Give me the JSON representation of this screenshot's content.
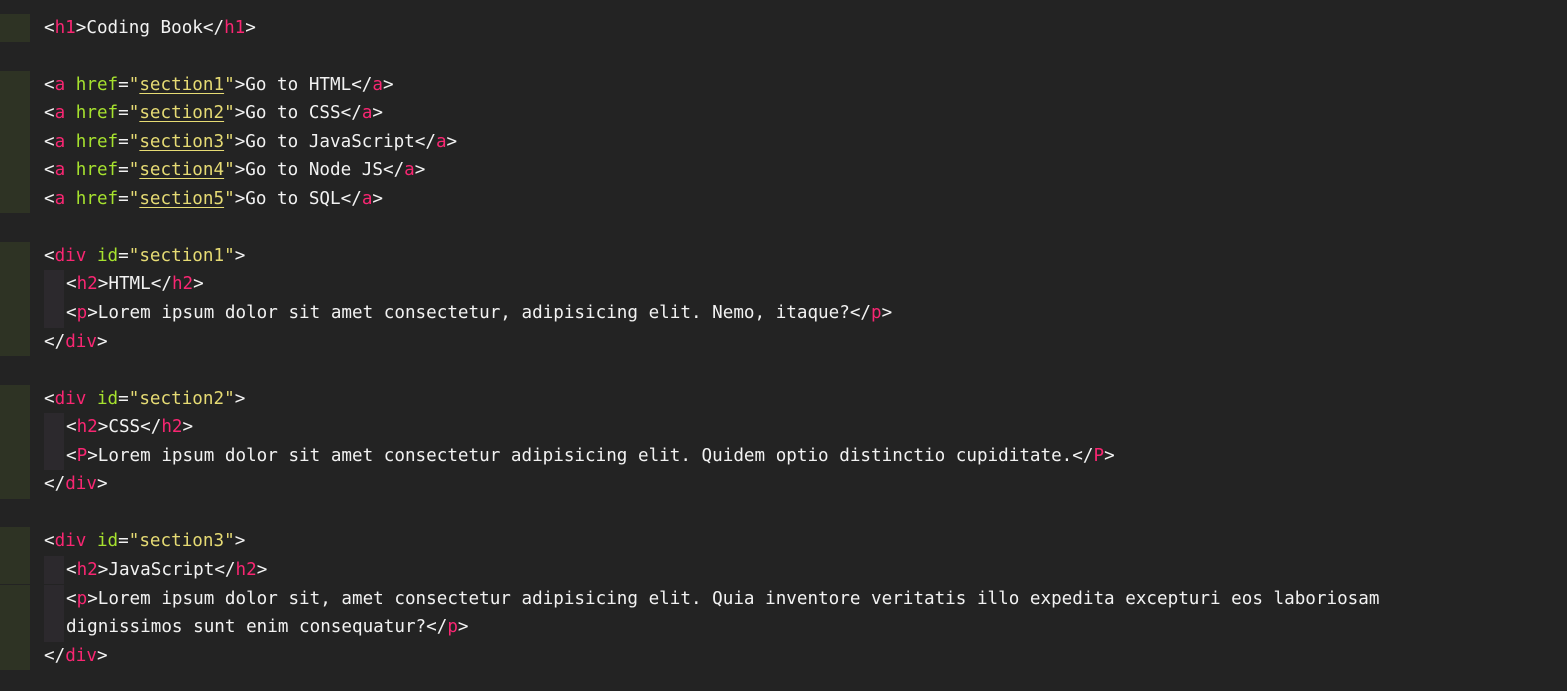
{
  "colors": {
    "background": "#232323",
    "gutter_modified": "#2e3324",
    "indent_guide": "#2c292d",
    "punctuation": "#f2f2f2",
    "tag": "#f92672",
    "attribute": "#a6e22e",
    "string": "#e6db74",
    "text": "#f2f2f2"
  },
  "lines": [
    {
      "tokens": [
        [
          "p",
          "<"
        ],
        [
          "t",
          "h1"
        ],
        [
          "p",
          ">"
        ],
        [
          "txt",
          "Coding Book"
        ],
        [
          "p",
          "</"
        ],
        [
          "t",
          "h1"
        ],
        [
          "p",
          ">"
        ]
      ]
    },
    {
      "tokens": []
    },
    {
      "tokens": [
        [
          "p",
          "<"
        ],
        [
          "t",
          "a"
        ],
        [
          "p",
          " "
        ],
        [
          "a",
          "href"
        ],
        [
          "p",
          "="
        ],
        [
          "s",
          "\""
        ],
        [
          "su",
          "section1"
        ],
        [
          "s",
          "\""
        ],
        [
          "p",
          ">"
        ],
        [
          "txt",
          "Go to HTML"
        ],
        [
          "p",
          "</"
        ],
        [
          "t",
          "a"
        ],
        [
          "p",
          ">"
        ]
      ]
    },
    {
      "tokens": [
        [
          "p",
          "<"
        ],
        [
          "t",
          "a"
        ],
        [
          "p",
          " "
        ],
        [
          "a",
          "href"
        ],
        [
          "p",
          "="
        ],
        [
          "s",
          "\""
        ],
        [
          "su",
          "section2"
        ],
        [
          "s",
          "\""
        ],
        [
          "p",
          ">"
        ],
        [
          "txt",
          "Go to CSS"
        ],
        [
          "p",
          "</"
        ],
        [
          "t",
          "a"
        ],
        [
          "p",
          ">"
        ]
      ]
    },
    {
      "tokens": [
        [
          "p",
          "<"
        ],
        [
          "t",
          "a"
        ],
        [
          "p",
          " "
        ],
        [
          "a",
          "href"
        ],
        [
          "p",
          "="
        ],
        [
          "s",
          "\""
        ],
        [
          "su",
          "section3"
        ],
        [
          "s",
          "\""
        ],
        [
          "p",
          ">"
        ],
        [
          "txt",
          "Go to JavaScript"
        ],
        [
          "p",
          "</"
        ],
        [
          "t",
          "a"
        ],
        [
          "p",
          ">"
        ]
      ]
    },
    {
      "tokens": [
        [
          "p",
          "<"
        ],
        [
          "t",
          "a"
        ],
        [
          "p",
          " "
        ],
        [
          "a",
          "href"
        ],
        [
          "p",
          "="
        ],
        [
          "s",
          "\""
        ],
        [
          "su",
          "section4"
        ],
        [
          "s",
          "\""
        ],
        [
          "p",
          ">"
        ],
        [
          "txt",
          "Go to Node JS"
        ],
        [
          "p",
          "</"
        ],
        [
          "t",
          "a"
        ],
        [
          "p",
          ">"
        ]
      ]
    },
    {
      "tokens": [
        [
          "p",
          "<"
        ],
        [
          "t",
          "a"
        ],
        [
          "p",
          " "
        ],
        [
          "a",
          "href"
        ],
        [
          "p",
          "="
        ],
        [
          "s",
          "\""
        ],
        [
          "su",
          "section5"
        ],
        [
          "s",
          "\""
        ],
        [
          "p",
          ">"
        ],
        [
          "txt",
          "Go to SQL"
        ],
        [
          "p",
          "</"
        ],
        [
          "t",
          "a"
        ],
        [
          "p",
          ">"
        ]
      ]
    },
    {
      "tokens": []
    },
    {
      "tokens": [
        [
          "p",
          "<"
        ],
        [
          "t",
          "div"
        ],
        [
          "p",
          " "
        ],
        [
          "a",
          "id"
        ],
        [
          "p",
          "="
        ],
        [
          "s",
          "\"section1\""
        ],
        [
          "p",
          ">"
        ]
      ]
    },
    {
      "tokens": [
        [
          "p",
          "<"
        ],
        [
          "t",
          "h2"
        ],
        [
          "p",
          ">"
        ],
        [
          "txt",
          "HTML"
        ],
        [
          "p",
          "</"
        ],
        [
          "t",
          "h2"
        ],
        [
          "p",
          ">"
        ]
      ]
    },
    {
      "tokens": [
        [
          "p",
          "<"
        ],
        [
          "t",
          "p"
        ],
        [
          "p",
          ">"
        ],
        [
          "txt",
          "Lorem ipsum dolor sit amet consectetur, adipisicing elit. Nemo, itaque?"
        ],
        [
          "p",
          "</"
        ],
        [
          "t",
          "p"
        ],
        [
          "p",
          ">"
        ]
      ]
    },
    {
      "tokens": [
        [
          "p",
          "</"
        ],
        [
          "t",
          "div"
        ],
        [
          "p",
          ">"
        ]
      ]
    },
    {
      "tokens": []
    },
    {
      "tokens": [
        [
          "p",
          "<"
        ],
        [
          "t",
          "div"
        ],
        [
          "p",
          " "
        ],
        [
          "a",
          "id"
        ],
        [
          "p",
          "="
        ],
        [
          "s",
          "\"section2\""
        ],
        [
          "p",
          ">"
        ]
      ]
    },
    {
      "tokens": [
        [
          "p",
          "<"
        ],
        [
          "t",
          "h2"
        ],
        [
          "p",
          ">"
        ],
        [
          "txt",
          "CSS"
        ],
        [
          "p",
          "</"
        ],
        [
          "t",
          "h2"
        ],
        [
          "p",
          ">"
        ]
      ]
    },
    {
      "tokens": [
        [
          "p",
          "<"
        ],
        [
          "t",
          "P"
        ],
        [
          "p",
          ">"
        ],
        [
          "txt",
          "Lorem ipsum dolor sit amet consectetur adipisicing elit. Quidem optio distinctio cupiditate."
        ],
        [
          "p",
          "</"
        ],
        [
          "t",
          "P"
        ],
        [
          "p",
          ">"
        ]
      ]
    },
    {
      "tokens": [
        [
          "p",
          "</"
        ],
        [
          "t",
          "div"
        ],
        [
          "p",
          ">"
        ]
      ]
    },
    {
      "tokens": []
    },
    {
      "tokens": [
        [
          "p",
          "<"
        ],
        [
          "t",
          "div"
        ],
        [
          "p",
          " "
        ],
        [
          "a",
          "id"
        ],
        [
          "p",
          "="
        ],
        [
          "s",
          "\"section3\""
        ],
        [
          "p",
          ">"
        ]
      ]
    },
    {
      "tokens": [
        [
          "p",
          "<"
        ],
        [
          "t",
          "h2"
        ],
        [
          "p",
          ">"
        ],
        [
          "txt",
          "JavaScript"
        ],
        [
          "p",
          "</"
        ],
        [
          "t",
          "h2"
        ],
        [
          "p",
          ">"
        ]
      ]
    },
    {
      "tokens": [
        [
          "p",
          "<"
        ],
        [
          "t",
          "p"
        ],
        [
          "p",
          ">"
        ],
        [
          "txt",
          "Lorem ipsum dolor sit, amet consectetur adipisicing elit. Quia inventore veritatis illo expedita excepturi eos laboriosam"
        ]
      ]
    },
    {
      "tokens": [
        [
          "txt",
          "dignissimos sunt enim consequatur?"
        ],
        [
          "p",
          "</"
        ],
        [
          "t",
          "p"
        ],
        [
          "p",
          ">"
        ]
      ]
    },
    {
      "tokens": [
        [
          "p",
          "</"
        ],
        [
          "t",
          "div"
        ],
        [
          "p",
          ">"
        ]
      ]
    }
  ]
}
